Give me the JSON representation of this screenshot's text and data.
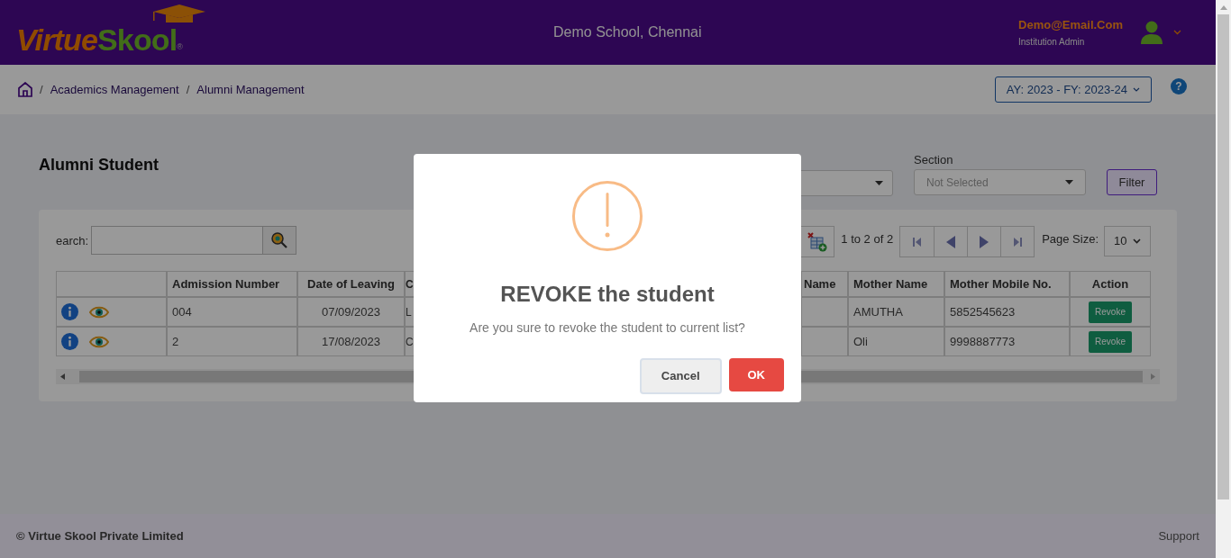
{
  "header": {
    "logo": {
      "part_1": "Virtue",
      "part_2": "Skool",
      "mark": "®"
    },
    "school": "Demo School, Chennai",
    "user": {
      "email": "Demo@Email.Com",
      "role": "Institution Admin"
    }
  },
  "breadcrumb": [
    {
      "separator": "/",
      "label": "Academics Management"
    },
    {
      "separator": "/",
      "label": "Alumni Management"
    }
  ],
  "year_selector": "AY: 2023 - FY: 2023-24",
  "help_button": "?",
  "page_title": "Alumni Student",
  "filters": {
    "section_label": "Section",
    "section_placeholder": "Not Selected",
    "filter_button": "Filter"
  },
  "search": {
    "label": "earch:"
  },
  "pager": {
    "summary": "1 to 2 of 2",
    "page_size_label": "Page Size:",
    "page_size": "10"
  },
  "table": {
    "columns": [
      "",
      "Admission Number",
      "Date of Leaving",
      "C",
      "",
      "Name",
      "Mother Name",
      "Mother Mobile No.",
      "Action"
    ],
    "rows": [
      {
        "admission": "004",
        "date": "07/09/2023",
        "column_4": "L",
        "mother": "AMUTHA",
        "mobile": "5852545623",
        "action": "Revoke"
      },
      {
        "admission": "2",
        "date": "17/08/2023",
        "column_4": "C",
        "mother": "Oli",
        "mobile": "9998887773",
        "action": "Revoke"
      }
    ]
  },
  "footer": {
    "copyright": "© Virtue Skool Private Limited",
    "support": "Support"
  },
  "dialog": {
    "title": "REVOKE the student",
    "message": "Are you sure to revoke the student to current list?",
    "buttons": [
      {
        "label": "Cancel",
        "kind": "secondary"
      },
      {
        "label": "OK",
        "kind": "primary"
      }
    ]
  }
}
